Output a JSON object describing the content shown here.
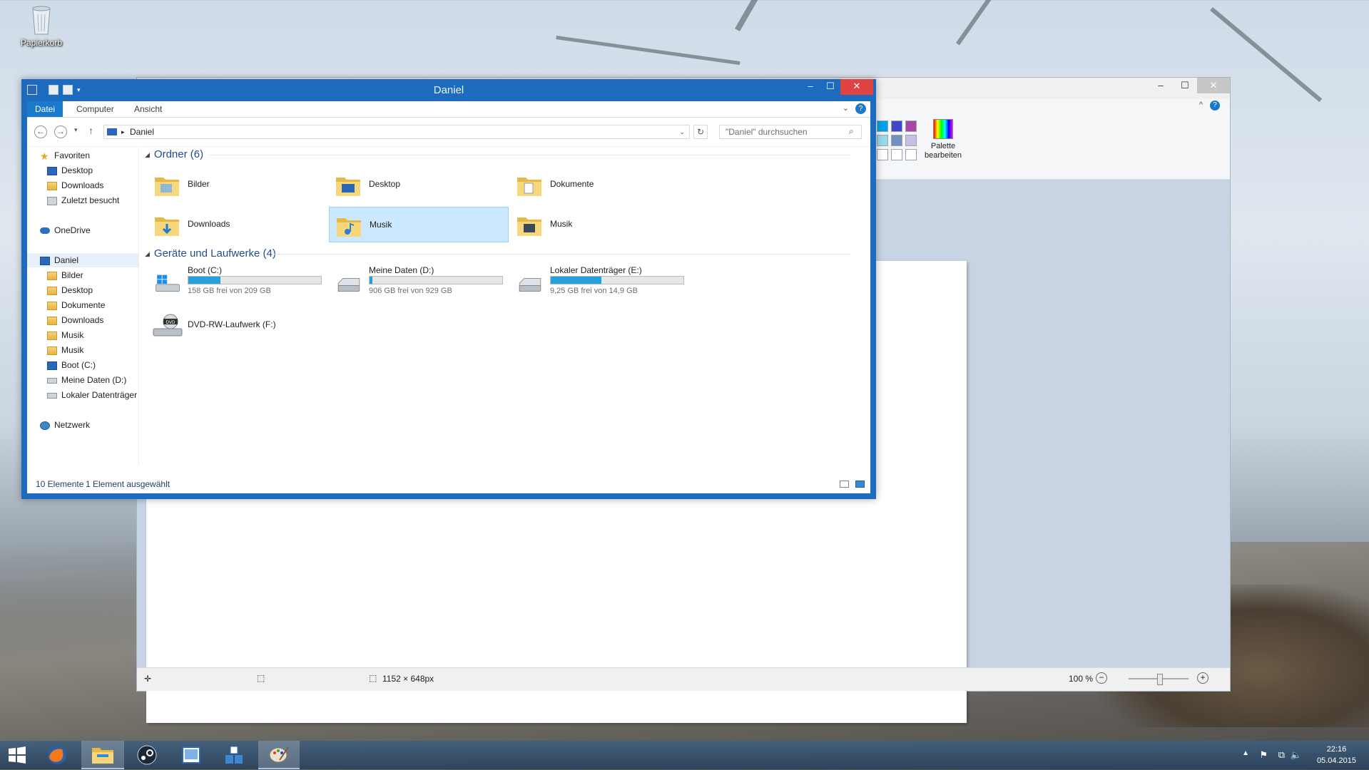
{
  "desktop": {
    "recycle_bin_label": "Papierkorb"
  },
  "paint": {
    "palette_label_1": "Palette",
    "palette_label_2": "bearbeiten",
    "canvas_size": "1152 × 648px",
    "zoom": "100 %"
  },
  "explorer": {
    "title": "Daniel",
    "tabs": [
      "Datei",
      "Computer",
      "Ansicht"
    ],
    "address_current": "Daniel",
    "search_placeholder": "\"Daniel\" durchsuchen",
    "nav": {
      "favorites": "Favoriten",
      "fav_items": [
        "Desktop",
        "Downloads",
        "Zuletzt besucht"
      ],
      "onedrive": "OneDrive",
      "pc": "Daniel",
      "pc_items": [
        "Bilder",
        "Desktop",
        "Dokumente",
        "Downloads",
        "Musik",
        "Musik",
        "Boot (C:)",
        "Meine Daten (D:)",
        "Lokaler Datenträger"
      ],
      "network": "Netzwerk"
    },
    "folders_header": "Ordner (6)",
    "folders": [
      "Bilder",
      "Desktop",
      "Dokumente",
      "Downloads",
      "Musik",
      "Musik"
    ],
    "devices_header": "Geräte und Laufwerke (4)",
    "drives": [
      {
        "name": "Boot (C:)",
        "free": "158 GB frei von 209 GB",
        "used_fraction": 0.24
      },
      {
        "name": "Meine Daten (D:)",
        "free": "906 GB frei von 929 GB",
        "used_fraction": 0.02
      },
      {
        "name": "Lokaler Datenträger (E:)",
        "free": "9,25 GB frei von 14,9 GB",
        "used_fraction": 0.38
      }
    ],
    "dvd_drive": "DVD-RW-Laufwerk (F:)",
    "status_count": "10 Elemente",
    "status_selected": "1 Element ausgewählt"
  },
  "taskbar": {
    "time": "22:16",
    "date": "05.04.2015"
  }
}
